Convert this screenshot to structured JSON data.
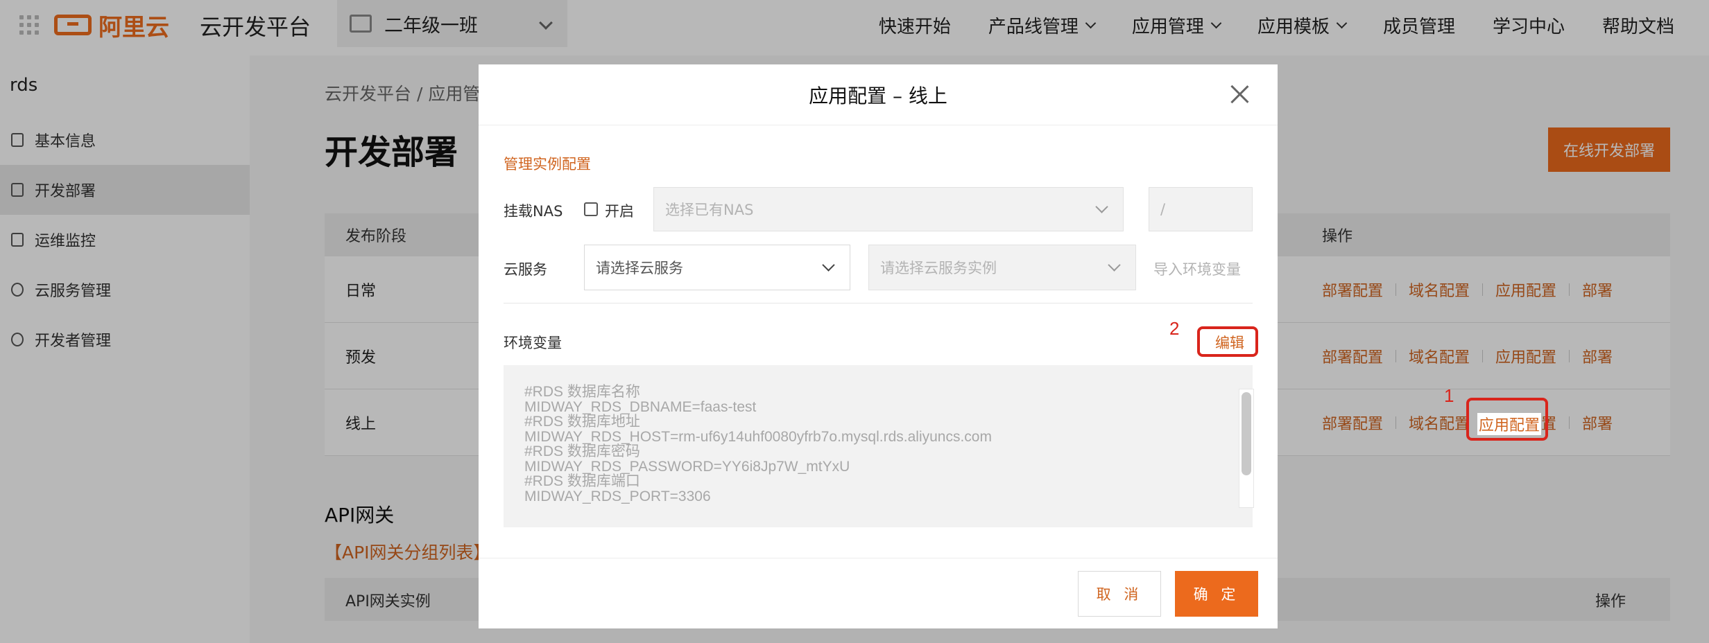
{
  "topnav": {
    "logo_text": "阿里云",
    "platform_title": "云开发平台",
    "team_selector": "二年级一班",
    "items": [
      {
        "label": "快速开始",
        "dropdown": false
      },
      {
        "label": "产品线管理",
        "dropdown": true
      },
      {
        "label": "应用管理",
        "dropdown": true
      },
      {
        "label": "应用模板",
        "dropdown": true
      },
      {
        "label": "成员管理",
        "dropdown": false
      },
      {
        "label": "学习中心",
        "dropdown": false
      },
      {
        "label": "帮助文档",
        "dropdown": false
      }
    ]
  },
  "sidebar": {
    "project_name": "rds",
    "items": [
      {
        "label": "基本信息",
        "icon": "document-icon",
        "active": false
      },
      {
        "label": "开发部署",
        "icon": "cube-icon",
        "active": true
      },
      {
        "label": "运维监控",
        "icon": "monitor-icon",
        "active": false
      },
      {
        "label": "云服务管理",
        "icon": "cloud-icon",
        "active": false
      },
      {
        "label": "开发者管理",
        "icon": "user-icon",
        "active": false
      }
    ]
  },
  "main": {
    "breadcrumb": "云开发平台 / 应用管",
    "page_title": "开发部署",
    "online_dev_button": "在线开发部署",
    "table": {
      "header_stage": "发布阶段",
      "header_ops": "操作",
      "rows": [
        {
          "stage": "日常",
          "ops": [
            "部署配置",
            "域名配置",
            "应用配置",
            "部署"
          ]
        },
        {
          "stage": "预发",
          "ops": [
            "部署配置",
            "域名配置",
            "应用配置",
            "部署"
          ]
        },
        {
          "stage": "线上",
          "ops": [
            "部署配置",
            "域名配置",
            "应用配置",
            "部署"
          ]
        }
      ]
    },
    "api_section_title": "API网关",
    "api_group_link": "【API网关分组列表】",
    "api_table_header_instance": "API网关实例",
    "api_table_header_ops": "操作"
  },
  "annotations": {
    "step1": "1",
    "step2": "2",
    "step1_target_label": "应用配置",
    "step2_target_label": "编辑",
    "color": "#d9251c"
  },
  "modal": {
    "title": "应用配置 – 线上",
    "section_title": "管理实例配置",
    "nas_label": "挂载NAS",
    "nas_enable_label": "开启",
    "nas_enable_checked": false,
    "nas_select_placeholder": "选择已有NAS",
    "nas_path_placeholder": "/",
    "cloud_service_label": "云服务",
    "cloud_service_placeholder": "请选择云服务",
    "cloud_instance_placeholder": "请选择云服务实例",
    "import_env_label": "导入环境变量",
    "env_label": "环境变量",
    "edit_button": "编辑",
    "env_content": "#RDS 数据库名称\nMIDWAY_RDS_DBNAME=faas-test\n#RDS 数据库地址\nMIDWAY_RDS_HOST=rm-uf6y14uhf0080yfrb7o.mysql.rds.aliyuncs.com\n#RDS 数据库密码\nMIDWAY_RDS_PASSWORD=YY6i8Jp7W_mtYxU\n#RDS 数据库端口\nMIDWAY_RDS_PORT=3306",
    "cancel_button": "取 消",
    "ok_button": "确 定"
  },
  "colors": {
    "accent": "#ec6a1d",
    "link": "#d06520",
    "annotation": "#d9251c"
  }
}
